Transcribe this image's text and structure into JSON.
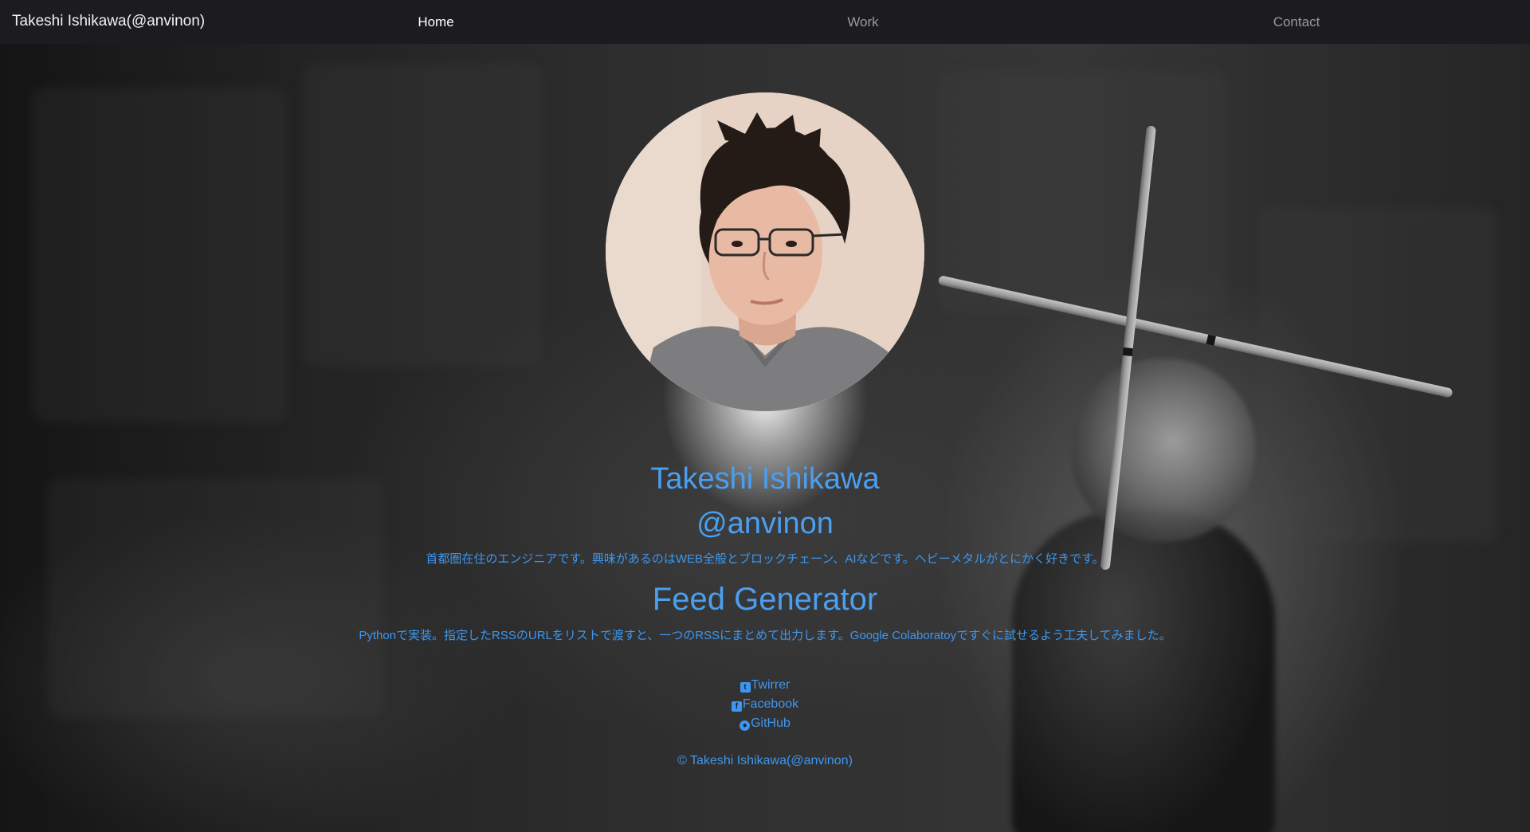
{
  "navbar": {
    "brand": "Takeshi Ishikawa(@anvinon)",
    "items": [
      {
        "label": "Home",
        "active": true
      },
      {
        "label": "Work",
        "active": false
      },
      {
        "label": "Contact",
        "active": false
      }
    ]
  },
  "profile": {
    "avatar_alt": "profile-photo",
    "name": "Takeshi Ishikawa",
    "handle": "@anvinon",
    "intro": "首都圏在住のエンジニアです。興味があるのはWEB全般とブロックチェーン、AIなどです。ヘビーメタルがとにかく好きです。"
  },
  "project": {
    "title": "Feed Generator",
    "description": "Pythonで実装。指定したRSSのURLをリストで渡すと、一つのRSSにまとめて出力します。Google Colaboratoyですぐに試せるよう工夫してみました。"
  },
  "social": [
    {
      "label": "Twirrer",
      "icon": "twitter-icon"
    },
    {
      "label": "Facebook",
      "icon": "facebook-icon"
    },
    {
      "label": "GitHub",
      "icon": "github-icon"
    }
  ],
  "footer": {
    "copyright": "© Takeshi Ishikawa(@anvinon)"
  },
  "colors": {
    "navbar_bg": "#1c1c20",
    "accent_text": "#4a9ff0",
    "nav_inactive": "#9a9a9a",
    "nav_active": "#ffffff"
  }
}
